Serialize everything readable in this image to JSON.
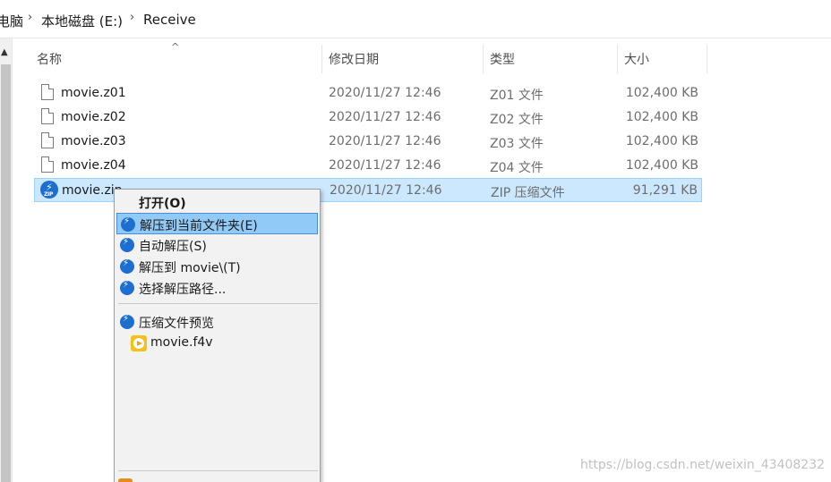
{
  "breadcrumb": {
    "items": [
      "电脑",
      "本地磁盘 (E:)",
      "Receive"
    ],
    "separator": "›"
  },
  "columns": {
    "name": "名称",
    "date": "修改日期",
    "type": "类型",
    "size": "大小",
    "sort_indicator": "^"
  },
  "files": [
    {
      "name": "movie.z01",
      "date": "2020/11/27 12:46",
      "type": "Z01 文件",
      "size": "102,400 KB",
      "icon": "file-icon"
    },
    {
      "name": "movie.z02",
      "date": "2020/11/27 12:46",
      "type": "Z02 文件",
      "size": "102,400 KB",
      "icon": "file-icon"
    },
    {
      "name": "movie.z03",
      "date": "2020/11/27 12:46",
      "type": "Z03 文件",
      "size": "102,400 KB",
      "icon": "file-icon"
    },
    {
      "name": "movie.z04",
      "date": "2020/11/27 12:46",
      "type": "Z04 文件",
      "size": "102,400 KB",
      "icon": "file-icon"
    },
    {
      "name": "movie.zip",
      "date": "2020/11/27 12:46",
      "type": "ZIP 压缩文件",
      "size": "91,291 KB",
      "icon": "bandizip-zip-icon",
      "selected": true
    }
  ],
  "context_menu": {
    "open": "打开(O)",
    "extract_here": "解压到当前文件夹(E)",
    "auto_extract": "自动解压(S)",
    "extract_to": "解压到 movie\\(T)",
    "choose_path": "选择解压路径...",
    "preview": "压缩文件预览",
    "preview_file": "movie.f4v"
  },
  "watermark": "https://blog.csdn.net/weixin_43408232",
  "colors": {
    "selection_bg": "#cce8ff",
    "selection_border": "#99d1ff",
    "menu_hover": "#91c9f7",
    "bandizip_blue": "#1c6fd1"
  }
}
